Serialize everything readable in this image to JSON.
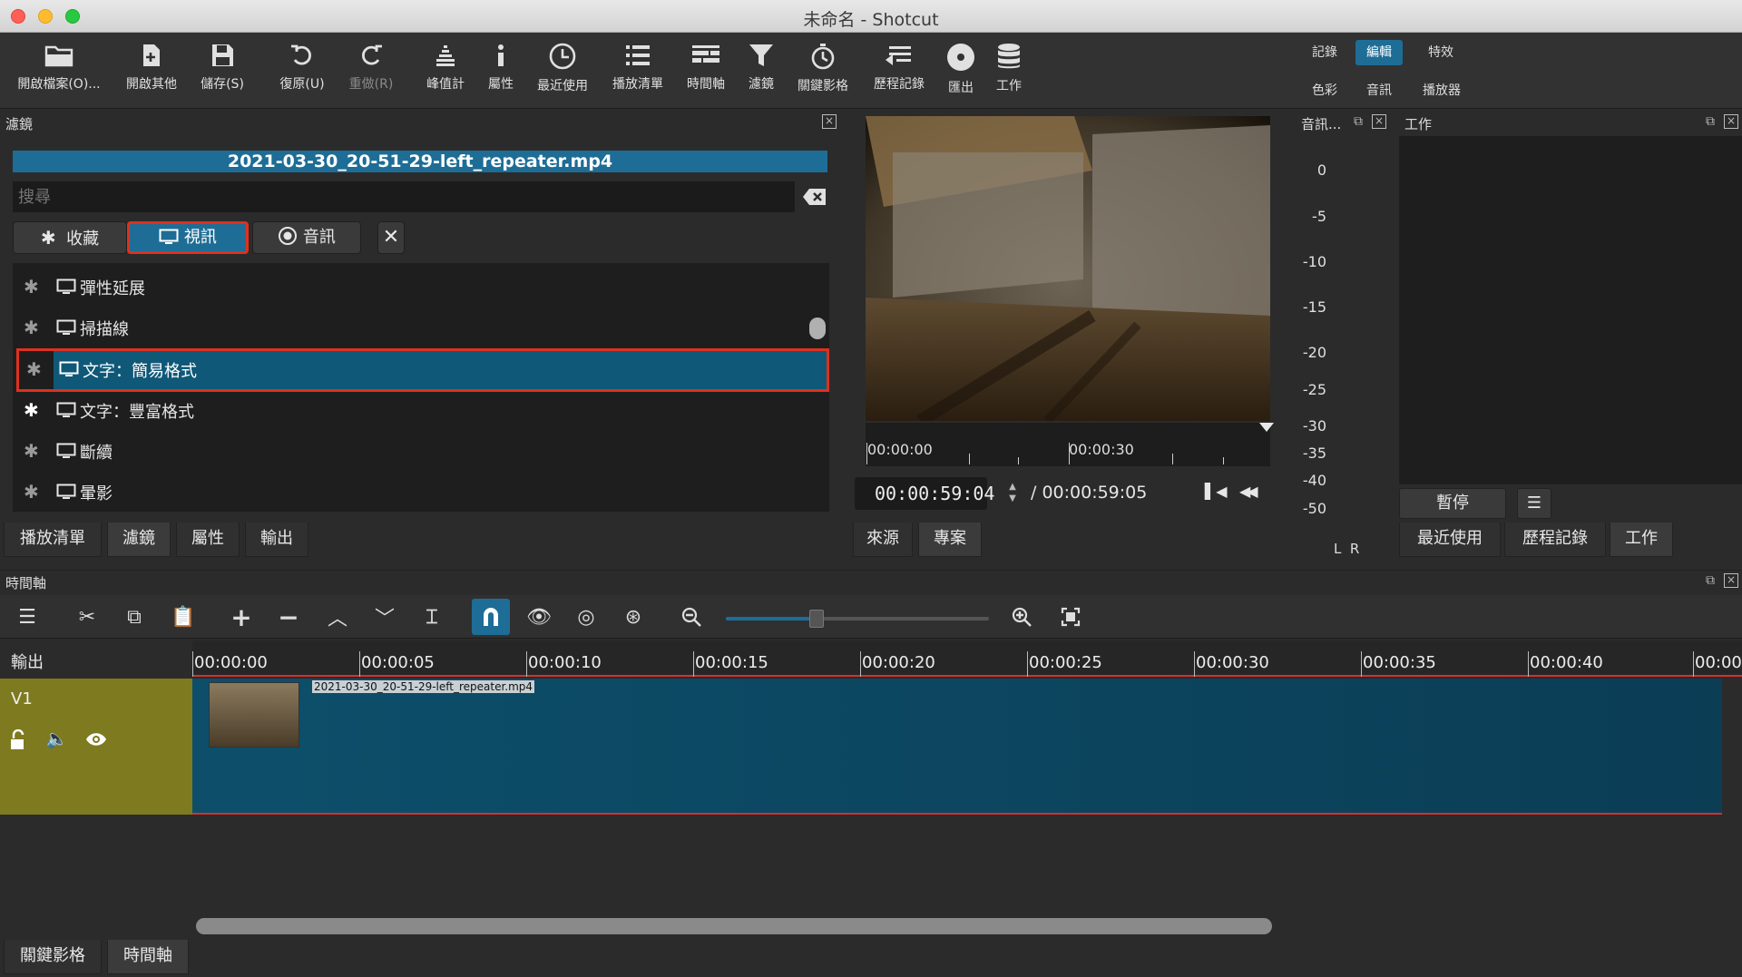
{
  "window": {
    "title": "未命名 - Shotcut"
  },
  "toolbar": {
    "buttons": [
      "開啟檔案(O)...",
      "開啟其他",
      "儲存(S)",
      "復原(U)",
      "重做(R)",
      "峰值計",
      "屬性",
      "最近使用",
      "播放清單",
      "時間軸",
      "濾鏡",
      "關鍵影格",
      "歷程記錄",
      "匯出",
      "工作"
    ]
  },
  "layouts": {
    "row1": [
      "記錄",
      "編輯",
      "特效"
    ],
    "row2": [
      "色彩",
      "音訊",
      "播放器"
    ],
    "active": "編輯"
  },
  "filters_panel": {
    "title": "濾鏡",
    "clip_name": "2021-03-30_20-51-29-left_repeater.mp4",
    "search_placeholder": "搜尋",
    "segments": [
      "收藏",
      "視訊",
      "音訊"
    ],
    "items": [
      {
        "label": "彈性延展"
      },
      {
        "label": "掃描線"
      },
      {
        "label": "文字：簡易格式",
        "selected": true
      },
      {
        "label": "文字：豐富格式"
      },
      {
        "label": "斷續"
      },
      {
        "label": "暈影"
      }
    ],
    "tabs": [
      "播放清單",
      "濾鏡",
      "屬性",
      "輸出"
    ]
  },
  "player": {
    "ruler": [
      "00:00:00",
      "00:00:30"
    ],
    "current_time": "00:00:59:04",
    "total_time": "/ 00:00:59:05",
    "tabs": [
      "來源",
      "專案"
    ]
  },
  "audio_meter": {
    "title": "音訊...",
    "scale": [
      "0",
      "-5",
      "-10",
      "-15",
      "-20",
      "-25",
      "-30",
      "-35",
      "-40",
      "-50"
    ],
    "channels": "L  R"
  },
  "jobs_panel": {
    "title": "工作",
    "pause_label": "暫停",
    "menu_label": "☰",
    "tabs": [
      "最近使用",
      "歷程記錄",
      "工作"
    ]
  },
  "timeline": {
    "title": "時間軸",
    "output_label": "輸出",
    "ruler": [
      "00:00:00",
      "00:00:05",
      "00:00:10",
      "00:00:15",
      "00:00:20",
      "00:00:25",
      "00:00:30",
      "00:00:35",
      "00:00:40",
      "00:00"
    ],
    "track_name": "V1",
    "clip_name": "2021-03-30_20-51-29-left_repeater.mp4",
    "bottom_tabs": [
      "關鍵影格",
      "時間軸"
    ]
  },
  "colors": {
    "accent": "#1e6d96",
    "highlight_border": "#e0301e",
    "track_header": "#7e7a20",
    "clip": "#0d4f6b"
  }
}
